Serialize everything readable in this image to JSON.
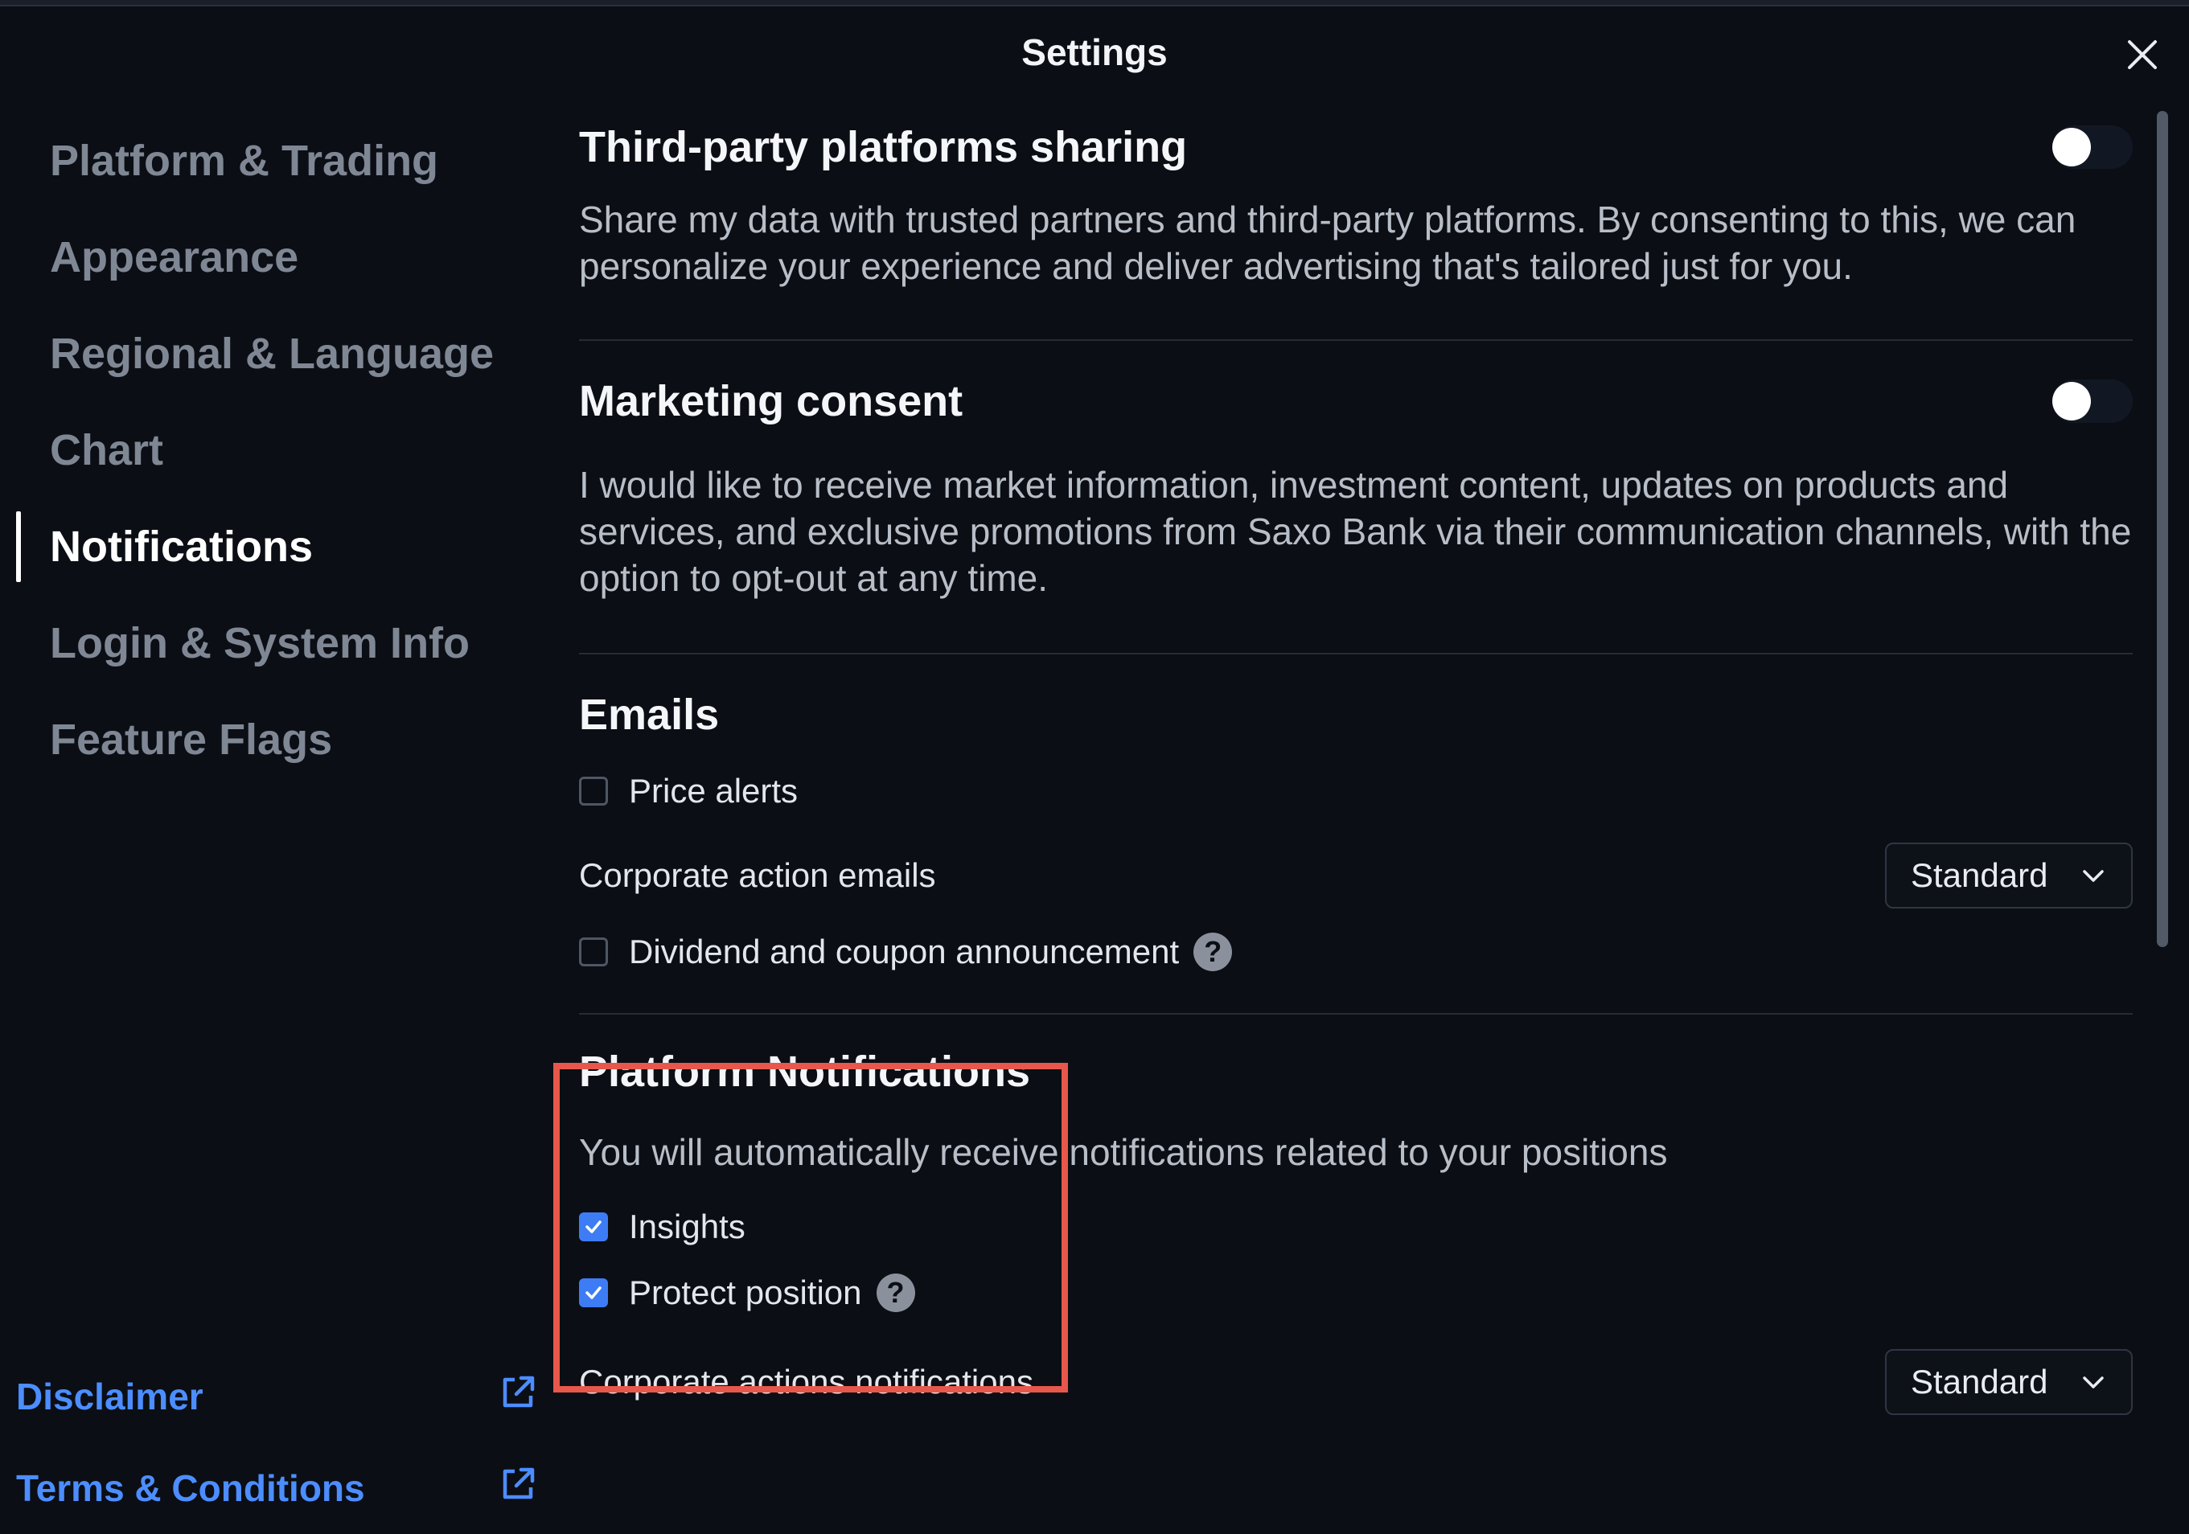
{
  "dialog": {
    "title": "Settings"
  },
  "sidebar": {
    "items": [
      {
        "label": "Platform & Trading"
      },
      {
        "label": "Appearance"
      },
      {
        "label": "Regional & Language"
      },
      {
        "label": "Chart"
      },
      {
        "label": "Notifications",
        "active": true
      },
      {
        "label": "Login & System Info"
      },
      {
        "label": "Feature Flags"
      }
    ],
    "links": [
      {
        "label": "Disclaimer",
        "icon": "external-link-icon"
      },
      {
        "label": "Terms & Conditions",
        "icon": "external-link-icon"
      }
    ]
  },
  "content": {
    "third_party": {
      "title": "Third-party platforms sharing",
      "description": "Share my data with trusted partners and third-party platforms. By consenting to this, we can personalize your experience and deliver advertising that's tailored just for you.",
      "enabled": false
    },
    "marketing": {
      "title": "Marketing consent",
      "description": "I would like to receive market information, investment content, updates on products and services, and exclusive promotions from Saxo Bank via their communication channels, with the option to opt-out at any time.",
      "enabled": false
    },
    "emails": {
      "title": "Emails",
      "price_alerts": {
        "label": "Price alerts",
        "checked": false
      },
      "corporate_action": {
        "label": "Corporate action emails",
        "value": "Standard"
      },
      "dividend": {
        "label": "Dividend and coupon announcement",
        "checked": false
      }
    },
    "platform_notifications": {
      "title": "Platform Notifications",
      "description": "You will automatically receive notifications related to your positions",
      "insights": {
        "label": "Insights",
        "checked": true
      },
      "protect_position": {
        "label": "Protect position",
        "checked": true
      },
      "corporate_actions": {
        "label": "Corporate actions notifications",
        "value": "Standard"
      }
    }
  },
  "colors": {
    "accent": "#3d7cf5",
    "link": "#4c8dff",
    "highlight": "#e8574b",
    "background": "#0b0e14"
  },
  "help_glyph": "?"
}
